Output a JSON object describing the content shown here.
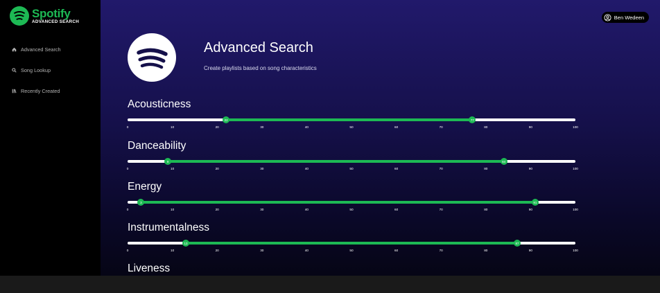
{
  "brand": {
    "name": "Spotify",
    "subtitle": "ADVANCED SEARCH"
  },
  "sidebar": {
    "items": [
      {
        "label": "Advanced Search",
        "icon": "home-icon"
      },
      {
        "label": "Song Lookup",
        "icon": "search-icon"
      },
      {
        "label": "Recently Created",
        "icon": "library-icon"
      }
    ]
  },
  "user": {
    "name": "Ben Wedeen",
    "icon": "user-circle-icon"
  },
  "header": {
    "title": "Advanced Search",
    "subtitle": "Create playlists based on song characteristics",
    "logo_icon": "spotify-logo-icon"
  },
  "colors": {
    "accent": "#1DB954",
    "sidebar_bg": "#000000",
    "main_bg_top": "#21196b",
    "track": "#ffffff"
  },
  "ticks": [
    "0",
    "10",
    "20",
    "30",
    "40",
    "50",
    "60",
    "70",
    "80",
    "90",
    "100"
  ],
  "sliders": [
    {
      "label": "Acousticness",
      "min": 22,
      "max": 77,
      "min_label": "22",
      "max_label": "77"
    },
    {
      "label": "Danceability",
      "min": 9,
      "max": 84,
      "min_label": "9",
      "max_label": "84"
    },
    {
      "label": "Energy",
      "min": 3,
      "max": 91,
      "min_label": "3",
      "max_label": "91"
    },
    {
      "label": "Instrumentalness",
      "min": 13,
      "max": 87,
      "min_label": "13",
      "max_label": "87"
    },
    {
      "label": "Liveness"
    }
  ]
}
